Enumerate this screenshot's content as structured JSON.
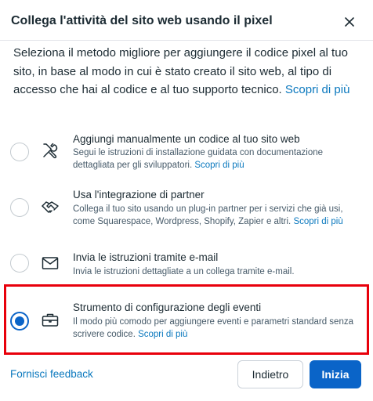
{
  "header": {
    "title": "Collega l'attività del sito web usando il pixel",
    "close_icon": "close-icon"
  },
  "intro": {
    "text": "Seleziona il metodo migliore per aggiungere il codice pixel al tuo sito, in base al modo in cui è stato creato il sito web, al tipo di accesso che hai al codice e al tuo supporto tecnico. ",
    "link": "Scopri di più"
  },
  "options": [
    {
      "icon": "tools-icon",
      "title": "Aggiungi manualmente un codice al tuo sito web",
      "description": "Segui le istruzioni di installazione guidata con documentazione dettagliata per gli sviluppatori. ",
      "link": "Scopri di più",
      "selected": false
    },
    {
      "icon": "handshake-icon",
      "title": "Usa l'integrazione di partner",
      "description": "Collega il tuo sito usando un plug-in partner per i servizi che già usi, come Squarespace, Wordpress, Shopify, Zapier e altri. ",
      "link": "Scopri di più",
      "selected": false
    },
    {
      "icon": "envelope-icon",
      "title": "Invia le istruzioni tramite e-mail",
      "description": "Invia le istruzioni dettagliate a un collega tramite e-mail.",
      "link": "",
      "selected": false
    },
    {
      "icon": "briefcase-icon",
      "title": "Strumento di configurazione degli eventi",
      "description": "Il modo più comodo per aggiungere eventi e parametri standard senza scrivere codice. ",
      "link": "Scopri di più",
      "selected": true
    }
  ],
  "footer": {
    "feedback_label": "Fornisci feedback",
    "back_label": "Indietro",
    "start_label": "Inizia"
  },
  "colors": {
    "accent": "#0a64c8",
    "link": "#0a78be",
    "highlight": "#e8000b"
  }
}
